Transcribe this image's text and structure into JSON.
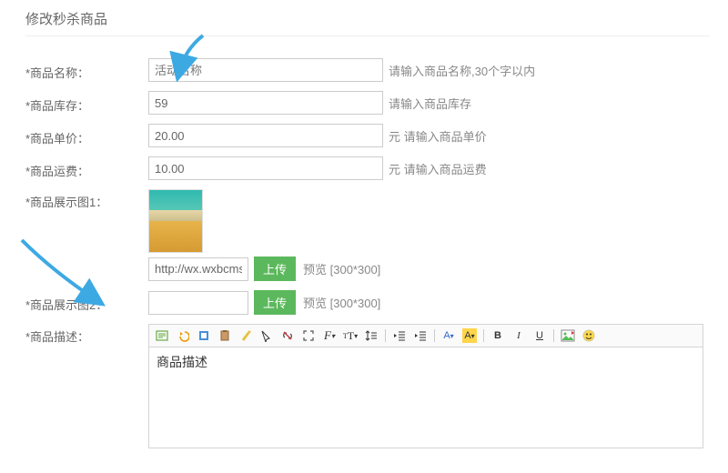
{
  "page_title": "修改秒杀商品",
  "fields": {
    "name": {
      "label": "*商品名称：",
      "placeholder": "活动名称",
      "value": "",
      "hint": "请输入商品名称,30个字以内"
    },
    "stock": {
      "label": "*商品库存：",
      "value": "59",
      "hint": "请输入商品库存"
    },
    "price": {
      "label": "*商品单价：",
      "value": "20.00",
      "hint": "元 请输入商品单价"
    },
    "shipping": {
      "label": "*商品运费：",
      "value": "10.00",
      "hint": "元 请输入商品运费"
    },
    "image1": {
      "label": "*商品展示图1：",
      "url_value": "http://wx.wxbcms.com/",
      "upload_btn": "上传",
      "preview": "预览 [300*300]"
    },
    "image2": {
      "label": "*商品展示图2：",
      "url_value": "",
      "upload_btn": "上传",
      "preview": "预览 [300*300]"
    },
    "desc": {
      "label": "*商品描述：",
      "content": "商品描述"
    }
  },
  "editor_toolbar": {
    "source": "",
    "undo": "",
    "redo": "",
    "paste": "",
    "broom": "",
    "select": "",
    "unlink": "",
    "fullscreen": "",
    "font": "F",
    "fontsize": "tT",
    "lineheight": "↕",
    "outdent": "",
    "indent": "",
    "forecolor": "A",
    "backcolor": "A",
    "bold": "B",
    "italic": "I",
    "underline": "U",
    "image": "",
    "emoji": ""
  }
}
